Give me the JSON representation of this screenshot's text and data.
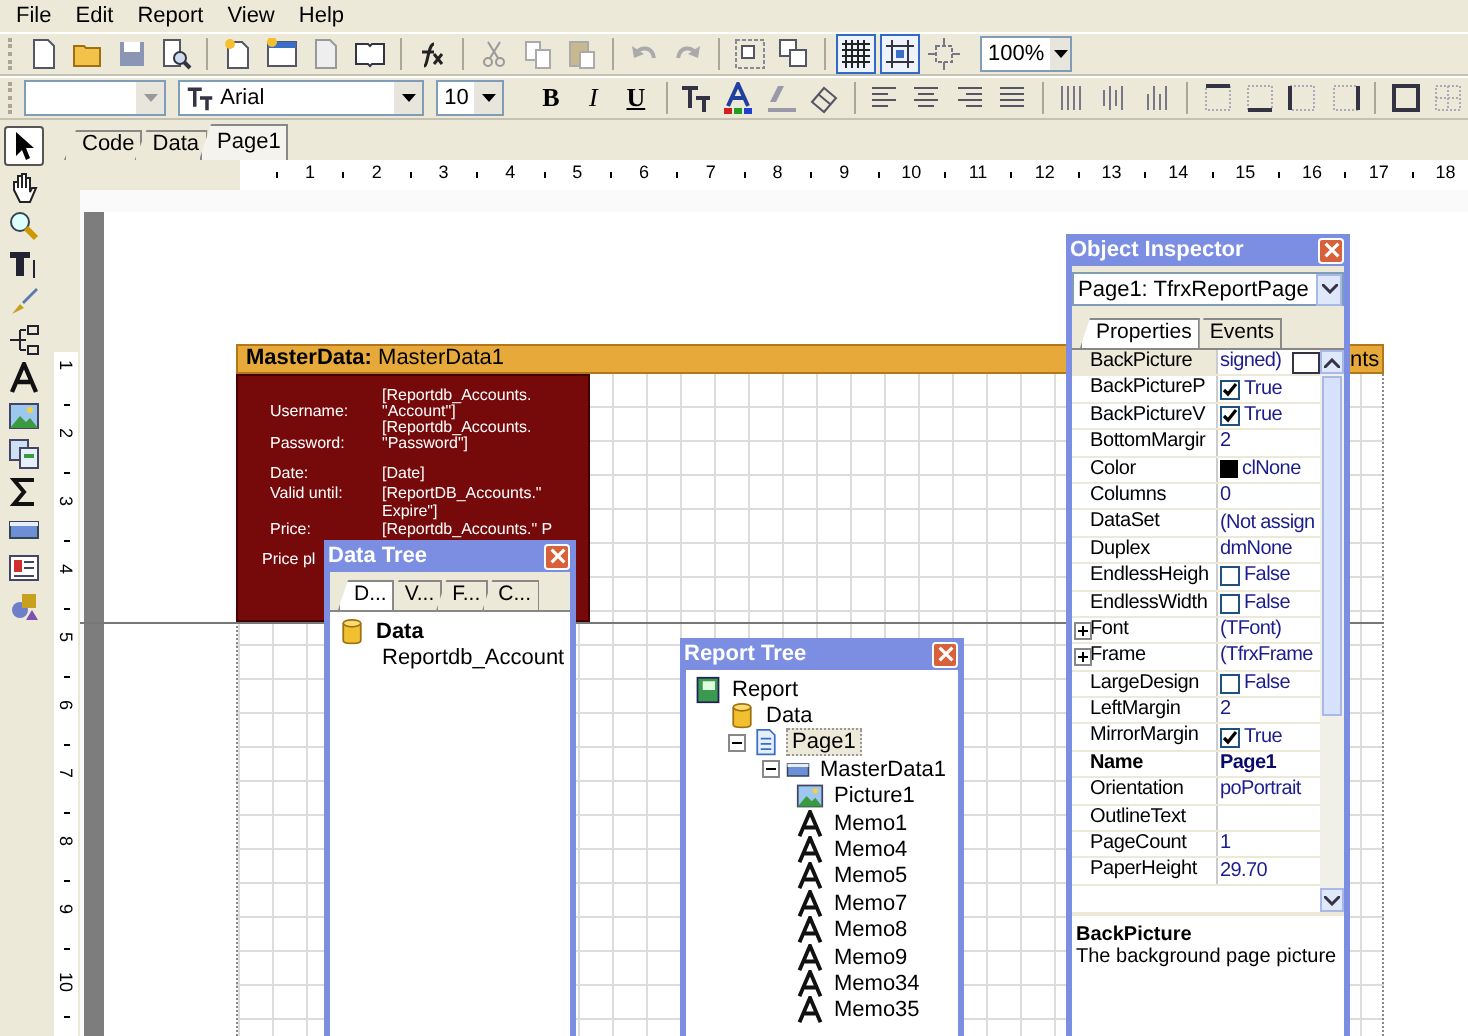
{
  "menu": [
    {
      "label": "File"
    },
    {
      "label": "Edit"
    },
    {
      "label": "Report"
    },
    {
      "label": "View"
    },
    {
      "label": "Help"
    }
  ],
  "toolbar": [
    {
      "kind": "new",
      "pressed": false
    },
    {
      "kind": "open",
      "pressed": false
    },
    {
      "kind": "save",
      "pressed": false
    },
    {
      "kind": "preview",
      "pressed": false
    },
    {
      "kind": "sep"
    },
    {
      "kind": "newpage",
      "pressed": false
    },
    {
      "kind": "dialog",
      "pressed": false
    },
    {
      "kind": "delpage",
      "pressed": false
    },
    {
      "kind": "book",
      "pressed": false
    },
    {
      "kind": "sep"
    },
    {
      "kind": "fx",
      "pressed": false
    },
    {
      "kind": "sep"
    },
    {
      "kind": "cut",
      "pressed": false
    },
    {
      "kind": "copy",
      "pressed": false
    },
    {
      "kind": "paste",
      "pressed": false
    },
    {
      "kind": "sep"
    },
    {
      "kind": "undo",
      "pressed": false
    },
    {
      "kind": "redo",
      "pressed": false
    },
    {
      "kind": "sep"
    },
    {
      "kind": "group",
      "pressed": false
    },
    {
      "kind": "ungroup",
      "pressed": false
    },
    {
      "kind": "sep"
    },
    {
      "kind": "grid",
      "pressed": true
    },
    {
      "kind": "snap",
      "pressed": true
    },
    {
      "kind": "fit",
      "pressed": false
    }
  ],
  "zoom": {
    "value": "100%"
  },
  "font": {
    "value": "Arial"
  },
  "font_size": {
    "value": "10"
  },
  "style_buttons": [
    {
      "label": "B",
      "kind": "bold",
      "pressed": false
    },
    {
      "label": "I",
      "kind": "italic",
      "pressed": false
    },
    {
      "label": "U",
      "kind": "underline",
      "pressed": false
    }
  ],
  "tools": [
    {
      "kind": "select",
      "selected": true
    },
    {
      "kind": "hand",
      "selected": false
    },
    {
      "kind": "zoom",
      "selected": false
    },
    {
      "kind": "text",
      "selected": false
    },
    {
      "kind": "brush",
      "selected": false
    },
    {
      "kind": "tree",
      "selected": false
    },
    {
      "kind": "memo",
      "selected": false
    },
    {
      "kind": "picture",
      "selected": false
    },
    {
      "kind": "subreport",
      "selected": false
    },
    {
      "kind": "sum",
      "selected": false
    },
    {
      "kind": "band",
      "selected": false
    },
    {
      "kind": "rich",
      "selected": false
    },
    {
      "kind": "shapes",
      "selected": false
    }
  ],
  "tabs": [
    {
      "label": "Code",
      "selected": false
    },
    {
      "label": "Data",
      "selected": false
    },
    {
      "label": "Page1",
      "selected": true
    }
  ],
  "ruler": {
    "horizontal": [
      "1",
      "2",
      "3",
      "4",
      "5",
      "6",
      "7",
      "8",
      "9",
      "10",
      "11",
      "12",
      "13",
      "14",
      "15",
      "16",
      "17",
      "18"
    ],
    "vertical": [
      "1",
      "2",
      "3",
      "4",
      "5",
      "6",
      "7",
      "8",
      "9",
      "10"
    ]
  },
  "band": {
    "type": "MasterData:",
    "name": "MasterData1",
    "cut_text": "nts"
  },
  "memos": [
    {
      "text": "[Reportdb_Accounts."
    },
    {
      "text": "Username:"
    },
    {
      "text": "\"Account\"]"
    },
    {
      "text": "[Reportdb_Accounts."
    },
    {
      "text": "Password:"
    },
    {
      "text": "\"Password\"]"
    },
    {
      "text": "Date:"
    },
    {
      "text": "[Date]"
    },
    {
      "text": "Valid until:"
    },
    {
      "text": "[ReportDB_Accounts.\""
    },
    {
      "text": "Expire\"]"
    },
    {
      "text": "Price:"
    },
    {
      "text": "[Reportdb_Accounts.\" P"
    },
    {
      "text": "Price pl"
    }
  ],
  "data_tree": {
    "title": "Data Tree",
    "tabs": [
      {
        "label": "D...",
        "selected": true
      },
      {
        "label": "V...",
        "selected": false
      },
      {
        "label": "F...",
        "selected": false
      },
      {
        "label": "C...",
        "selected": false
      }
    ],
    "items": [
      {
        "label": "Data",
        "kind": "database",
        "bold": true,
        "children": [
          {
            "label": "Reportdb_Account",
            "kind": "table",
            "bold": false
          }
        ]
      }
    ]
  },
  "report_tree": {
    "title": "Report Tree",
    "items": [
      {
        "label": "Report",
        "kind": "report",
        "selected": false,
        "children": [
          {
            "label": "Data",
            "kind": "database",
            "selected": false
          },
          {
            "label": "Page1",
            "kind": "page",
            "selected": true,
            "expanded": true,
            "children": [
              {
                "label": "MasterData1",
                "kind": "band",
                "selected": false,
                "expanded": true,
                "children": [
                  {
                    "label": "Picture1",
                    "kind": "picture",
                    "selected": false
                  },
                  {
                    "label": "Memo1",
                    "kind": "memo",
                    "selected": false
                  },
                  {
                    "label": "Memo4",
                    "kind": "memo",
                    "selected": false
                  },
                  {
                    "label": "Memo5",
                    "kind": "memo",
                    "selected": false
                  },
                  {
                    "label": "Memo7",
                    "kind": "memo",
                    "selected": false
                  },
                  {
                    "label": "Memo8",
                    "kind": "memo",
                    "selected": false
                  },
                  {
                    "label": "Memo9",
                    "kind": "memo",
                    "selected": false
                  },
                  {
                    "label": "Memo34",
                    "kind": "memo",
                    "selected": false
                  },
                  {
                    "label": "Memo35",
                    "kind": "memo",
                    "selected": false
                  }
                ]
              }
            ]
          }
        ]
      }
    ]
  },
  "object_inspector": {
    "title": "Object Inspector",
    "object": "Page1: TfrxReportPage",
    "tabs": [
      {
        "label": "Properties",
        "selected": true
      },
      {
        "label": "Events",
        "selected": false
      }
    ],
    "properties": [
      {
        "name": "BackPicture",
        "value": "signed)",
        "kind": "ellipsis",
        "selected": true
      },
      {
        "name": "BackPictureP",
        "value": "True",
        "kind": "bool",
        "checked": true,
        "selected": false
      },
      {
        "name": "BackPictureV",
        "value": "True",
        "kind": "bool",
        "checked": true,
        "selected": false
      },
      {
        "name": "BottomMargir",
        "value": "2",
        "kind": "text",
        "selected": false
      },
      {
        "name": "Color",
        "value": "clNone",
        "kind": "color",
        "color": "#000000",
        "selected": false
      },
      {
        "name": "Columns",
        "value": "0",
        "kind": "text",
        "selected": false
      },
      {
        "name": "DataSet",
        "value": "(Not assign",
        "kind": "text",
        "selected": false
      },
      {
        "name": "Duplex",
        "value": "dmNone",
        "kind": "text",
        "selected": false
      },
      {
        "name": "EndlessHeigh",
        "value": "False",
        "kind": "bool",
        "checked": false,
        "selected": false
      },
      {
        "name": "EndlessWidth",
        "value": "False",
        "kind": "bool",
        "checked": false,
        "selected": false
      },
      {
        "name": "Font",
        "value": "(TFont)",
        "kind": "group",
        "expanded": false,
        "selected": false
      },
      {
        "name": "Frame",
        "value": "(TfrxFrame",
        "kind": "group",
        "expanded": false,
        "selected": false
      },
      {
        "name": "LargeDesign",
        "value": "False",
        "kind": "bool",
        "checked": false,
        "selected": false
      },
      {
        "name": "LeftMargin",
        "value": "2",
        "kind": "text",
        "selected": false
      },
      {
        "name": "MirrorMargin",
        "value": "True",
        "kind": "bool",
        "checked": true,
        "selected": false
      },
      {
        "name": "Name",
        "value": "Page1",
        "kind": "name",
        "selected": false
      },
      {
        "name": "Orientation",
        "value": "poPortrait",
        "kind": "text",
        "selected": false
      },
      {
        "name": "OutlineText",
        "kind": "text",
        "selected": false
      },
      {
        "name": "PageCount",
        "value": "1",
        "kind": "text",
        "selected": false
      },
      {
        "name": "PaperHeight",
        "value": "29.70",
        "kind": "text",
        "selected": false
      }
    ],
    "description": {
      "title": "BackPicture",
      "text": "The background page picture"
    }
  }
}
